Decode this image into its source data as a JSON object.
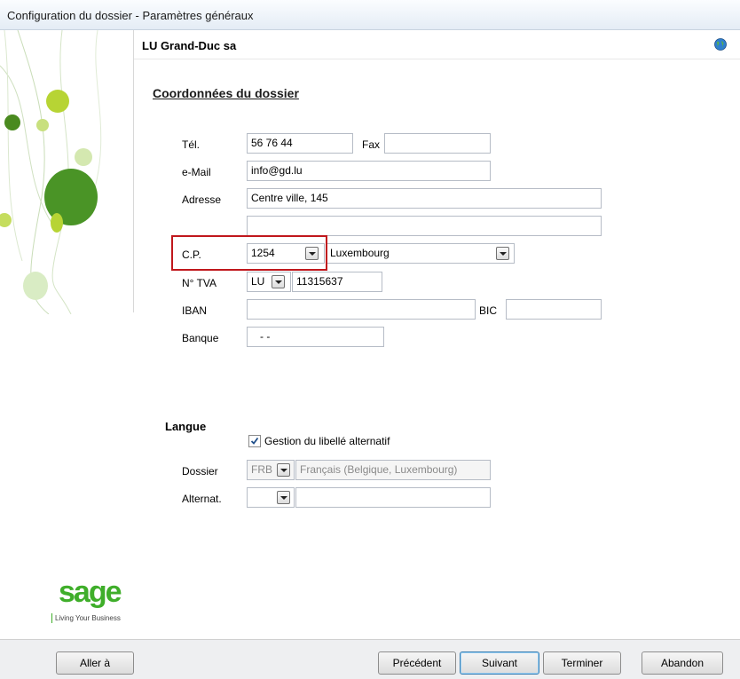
{
  "window": {
    "title": "Configuration du dossier - Paramètres généraux"
  },
  "header": {
    "company": "LU Grand-Duc sa"
  },
  "coordonnees": {
    "section_title": "Coordonnées du dossier",
    "tel_label": "Tél.",
    "tel_value": "56 76 44",
    "fax_label": "Fax",
    "fax_value": "",
    "email_label": "e-Mail",
    "email_value": "info@gd.lu",
    "adresse_label": "Adresse",
    "adresse_value": "Centre ville, 145",
    "adresse2_value": "",
    "cp_label": "C.P.",
    "cp_value": "1254",
    "city_value": "Luxembourg",
    "tva_label": "N° TVA",
    "tva_country": "LU",
    "tva_value": "11315637",
    "iban_label": "IBAN",
    "iban_value": "",
    "bic_label": "BIC",
    "bic_value": "",
    "banque_label": "Banque",
    "banque_value": "-     -"
  },
  "langue": {
    "title": "Langue",
    "gestion_label": "Gestion du libellé alternatif",
    "gestion_checked": true,
    "dossier_label": "Dossier",
    "dossier_code": "FRB",
    "dossier_name": "Français (Belgique, Luxembourg)",
    "alternat_label": "Alternat.",
    "alternat_code": "",
    "alternat_name": ""
  },
  "brand": {
    "logo": "sage",
    "tagline": "Living Your Business",
    "color": "#3fae2a"
  },
  "footer": {
    "aller_a": "Aller à",
    "precedent": "Précédent",
    "suivant": "Suivant",
    "terminer": "Terminer",
    "abandon": "Abandon"
  }
}
